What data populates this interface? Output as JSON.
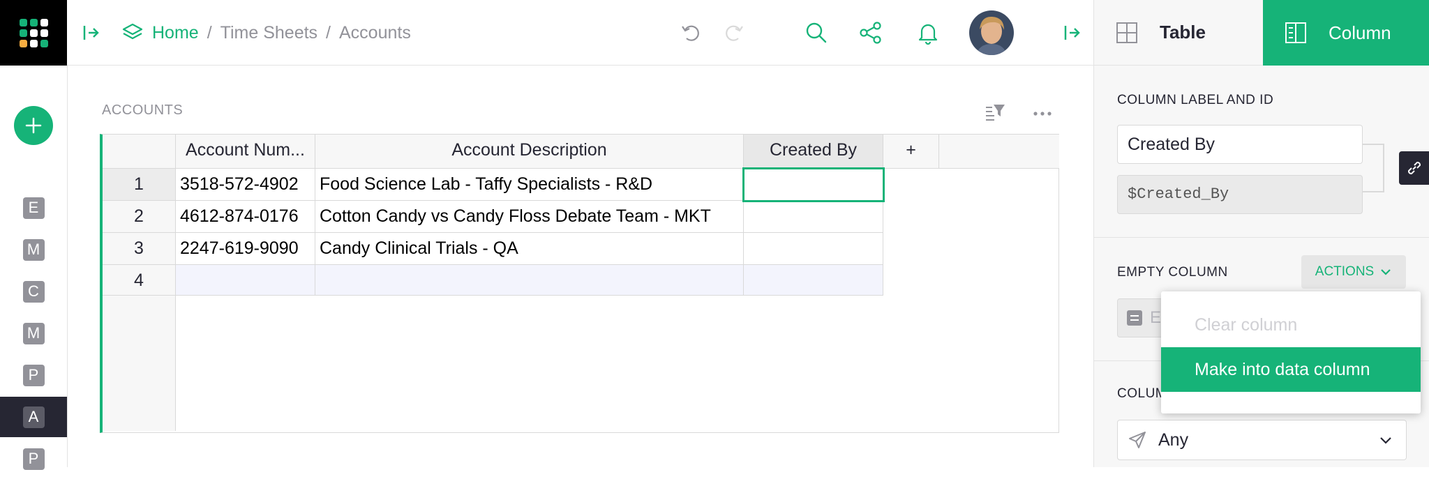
{
  "breadcrumb": {
    "home": "Home",
    "sep1": "/",
    "folder": "Time Sheets",
    "sep2": "/",
    "page": "Accounts"
  },
  "sidebar": {
    "pages": [
      {
        "initial": "E",
        "active": false
      },
      {
        "initial": "M",
        "active": false
      },
      {
        "initial": "C",
        "active": false
      },
      {
        "initial": "M",
        "active": false
      },
      {
        "initial": "P",
        "active": false
      },
      {
        "initial": "A",
        "active": true
      },
      {
        "initial": "P",
        "active": false
      }
    ]
  },
  "main": {
    "section_title": "ACCOUNTS",
    "columns": [
      {
        "label": "Account Num..."
      },
      {
        "label": "Account Description"
      },
      {
        "label": "Created By"
      },
      {
        "label": "+"
      }
    ],
    "rows": [
      {
        "num": "1",
        "cells": [
          "3518-572-4902",
          "Food Science Lab - Taffy Specialists - R&D",
          ""
        ]
      },
      {
        "num": "2",
        "cells": [
          "4612-874-0176",
          "Cotton Candy vs Candy Floss Debate Team - MKT",
          ""
        ]
      },
      {
        "num": "3",
        "cells": [
          "2247-619-9090",
          "Candy Clinical Trials - QA",
          ""
        ]
      },
      {
        "num": "4",
        "cells": [
          "",
          "",
          ""
        ]
      }
    ]
  },
  "panel": {
    "tab_table": "Table",
    "tab_column": "Column",
    "label_section": "COLUMN LABEL AND ID",
    "column_label": "Created By",
    "column_id": "$Created_By",
    "empty_column": "EMPTY COLUMN",
    "actions": "ACTIONS",
    "formula_placeholder": "E",
    "column_type_label": "COLUM",
    "type_value": "Any"
  },
  "menu": {
    "items": [
      {
        "label": "Clear column",
        "state": "disabled"
      },
      {
        "label": "Make into data column",
        "state": "active"
      }
    ]
  },
  "colors": {
    "accent": "#16b378",
    "dark": "#262633",
    "muted": "#929299"
  }
}
